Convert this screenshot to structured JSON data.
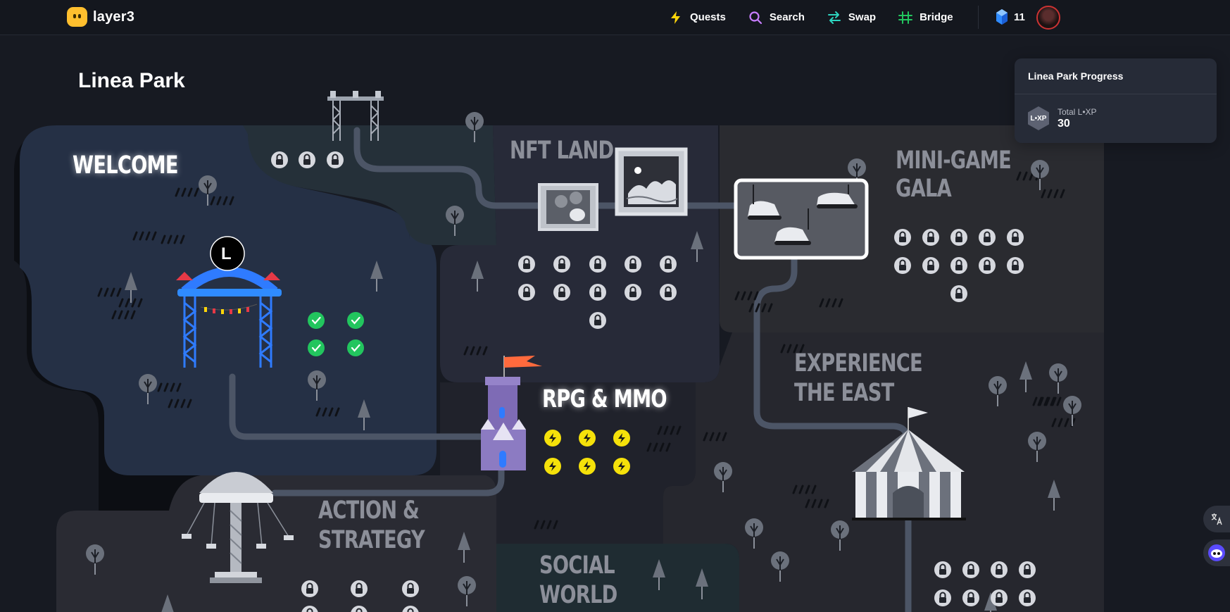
{
  "app": {
    "name": "layer3"
  },
  "nav": {
    "quests": "Quests",
    "search": "Search",
    "swap": "Swap",
    "bridge": "Bridge"
  },
  "user": {
    "gems": "11"
  },
  "page": {
    "title": "Linea Park"
  },
  "progress": {
    "title": "Linea Park Progress",
    "label": "Total L•XP",
    "value": "30",
    "badge": "L•XP"
  },
  "zones": {
    "welcome": "WELCOME",
    "nft_land": "NFT LAND",
    "mini_game_1": "MINI-GAME",
    "mini_game_2": "GALA",
    "rpg": "RPG & MMO",
    "experience_1": "EXPERIENCE",
    "experience_2": "THE EAST",
    "action_1": "ACTION &",
    "action_2": "STRATEGY",
    "social_1": "SOCIAL",
    "social_2": "WORLD"
  },
  "gate_logo": "L",
  "colors": {
    "completed": "#22c55e",
    "available": "#f5e10a",
    "locked": "#d6d8de",
    "accent_blue": "#2f7bff"
  }
}
